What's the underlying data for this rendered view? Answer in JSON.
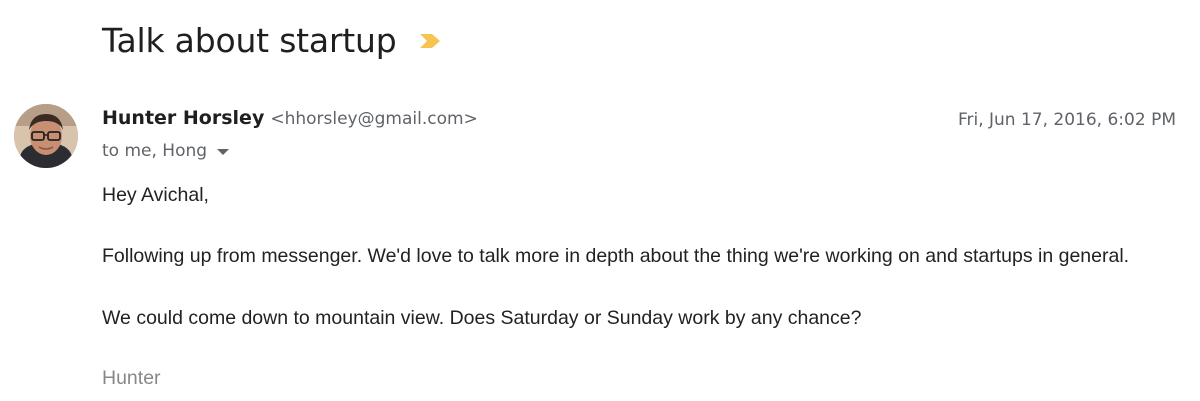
{
  "email": {
    "subject": "Talk about startup",
    "importance_marker": "important-marker-icon",
    "sender": {
      "name": "Hunter Horsley",
      "email": "<hhorsley@gmail.com>",
      "avatar": "avatar-photo"
    },
    "date": "Fri, Jun 17, 2016, 6:02 PM",
    "recipients": "to me, Hong",
    "body": {
      "greeting": "Hey Avichal,",
      "paragraph1": "Following up from messenger. We'd love to talk more in depth about the thing we're working on and startups in general.",
      "paragraph2": "We could come down to mountain view. Does Saturday or Sunday work by any chance?",
      "signature": "Hunter"
    }
  },
  "colors": {
    "importance_marker": "#f5c451",
    "secondary_text": "#5f6368",
    "body_text": "#222222",
    "signature_text": "#888888"
  }
}
